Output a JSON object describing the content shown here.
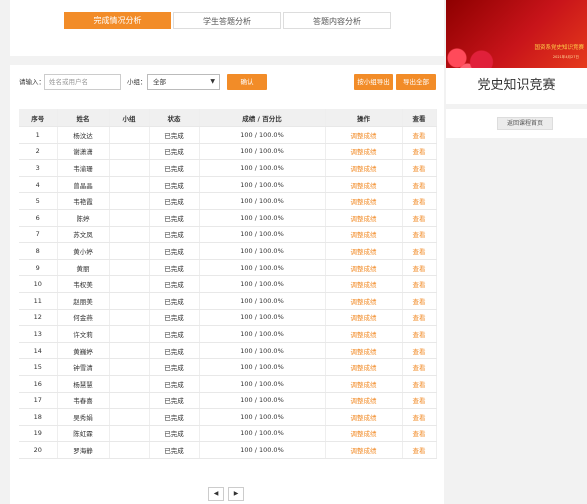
{
  "tabs": [
    "完成情况分析",
    "学生答题分析",
    "答题内容分析"
  ],
  "filters": {
    "search_label": "请输入：",
    "search_placeholder": "姓名或用户名",
    "group_label": "小组：",
    "group_value": "全部",
    "confirm_label": "确认",
    "export_group_label": "按小组导出",
    "export_all_label": "导出全部"
  },
  "table": {
    "headers": [
      "序号",
      "姓名",
      "小组",
      "状态",
      "成绩 / 百分比",
      "操作",
      "查看"
    ],
    "rows": [
      {
        "no": "1",
        "name": "杨汶达",
        "group": "",
        "status": "已完成",
        "score": "100 / 100.0%",
        "action": "调整成绩",
        "view": "查看"
      },
      {
        "no": "2",
        "name": "谢潇潇",
        "group": "",
        "status": "已完成",
        "score": "100 / 100.0%",
        "action": "调整成绩",
        "view": "查看"
      },
      {
        "no": "3",
        "name": "韦渝珊",
        "group": "",
        "status": "已完成",
        "score": "100 / 100.0%",
        "action": "调整成绩",
        "view": "查看"
      },
      {
        "no": "4",
        "name": "曾晶晶",
        "group": "",
        "status": "已完成",
        "score": "100 / 100.0%",
        "action": "调整成绩",
        "view": "查看"
      },
      {
        "no": "5",
        "name": "韦艳霞",
        "group": "",
        "status": "已完成",
        "score": "100 / 100.0%",
        "action": "调整成绩",
        "view": "查看"
      },
      {
        "no": "6",
        "name": "陈婷",
        "group": "",
        "status": "已完成",
        "score": "100 / 100.0%",
        "action": "调整成绩",
        "view": "查看"
      },
      {
        "no": "7",
        "name": "苏文凤",
        "group": "",
        "status": "已完成",
        "score": "100 / 100.0%",
        "action": "调整成绩",
        "view": "查看"
      },
      {
        "no": "8",
        "name": "黄小婷",
        "group": "",
        "status": "已完成",
        "score": "100 / 100.0%",
        "action": "调整成绩",
        "view": "查看"
      },
      {
        "no": "9",
        "name": "黄丽",
        "group": "",
        "status": "已完成",
        "score": "100 / 100.0%",
        "action": "调整成绩",
        "view": "查看"
      },
      {
        "no": "10",
        "name": "韦权美",
        "group": "",
        "status": "已完成",
        "score": "100 / 100.0%",
        "action": "调整成绩",
        "view": "查看"
      },
      {
        "no": "11",
        "name": "赵丽美",
        "group": "",
        "status": "已完成",
        "score": "100 / 100.0%",
        "action": "调整成绩",
        "view": "查看"
      },
      {
        "no": "12",
        "name": "何金燕",
        "group": "",
        "status": "已完成",
        "score": "100 / 100.0%",
        "action": "调整成绩",
        "view": "查看"
      },
      {
        "no": "13",
        "name": "许文莉",
        "group": "",
        "status": "已完成",
        "score": "100 / 100.0%",
        "action": "调整成绩",
        "view": "查看"
      },
      {
        "no": "14",
        "name": "黄巍婷",
        "group": "",
        "status": "已完成",
        "score": "100 / 100.0%",
        "action": "调整成绩",
        "view": "查看"
      },
      {
        "no": "15",
        "name": "钟雪清",
        "group": "",
        "status": "已完成",
        "score": "100 / 100.0%",
        "action": "调整成绩",
        "view": "查看"
      },
      {
        "no": "16",
        "name": "杨慧慧",
        "group": "",
        "status": "已完成",
        "score": "100 / 100.0%",
        "action": "调整成绩",
        "view": "查看"
      },
      {
        "no": "17",
        "name": "韦春喜",
        "group": "",
        "status": "已完成",
        "score": "100 / 100.0%",
        "action": "调整成绩",
        "view": "查看"
      },
      {
        "no": "18",
        "name": "吴秀娟",
        "group": "",
        "status": "已完成",
        "score": "100 / 100.0%",
        "action": "调整成绩",
        "view": "查看"
      },
      {
        "no": "19",
        "name": "陈虹霖",
        "group": "",
        "status": "已完成",
        "score": "100 / 100.0%",
        "action": "调整成绩",
        "view": "查看"
      },
      {
        "no": "20",
        "name": "罗海静",
        "group": "",
        "status": "已完成",
        "score": "100 / 100.0%",
        "action": "调整成绩",
        "view": "查看"
      }
    ]
  },
  "pager": {
    "prev": "◀",
    "next": "▶"
  },
  "sidebar": {
    "banner_title": "国资系党史知识竞赛",
    "banner_date": "2021年4月27日",
    "title": "党史知识竞赛",
    "back_label": "返回课程首页"
  },
  "colors": {
    "accent": "#f28c28",
    "banner": "#c8141a"
  }
}
